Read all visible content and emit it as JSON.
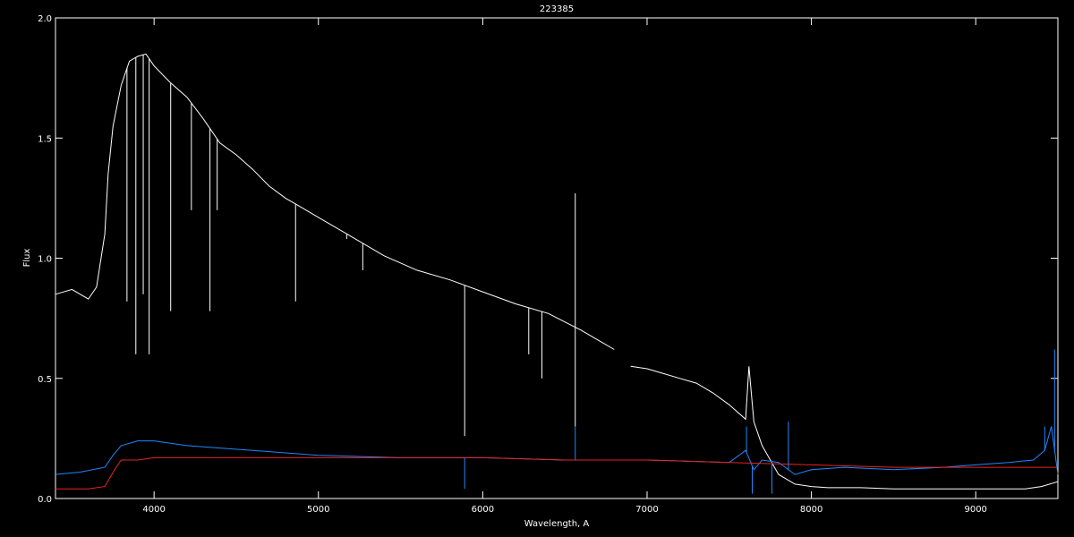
{
  "chart_data": {
    "type": "line",
    "title": "223385",
    "xlabel": "Wavelength, A",
    "ylabel": "Flux",
    "xlim": [
      3400,
      9500
    ],
    "ylim": [
      0,
      2.0
    ],
    "xticks": [
      4000,
      5000,
      6000,
      7000,
      8000,
      9000
    ],
    "yticks": [
      0.0,
      0.5,
      1.0,
      1.5,
      2.0
    ],
    "ytick_labels": [
      "0.0",
      "0.5",
      "1.0",
      "1.5",
      "2.0"
    ],
    "grid": false,
    "background": "#000000",
    "series": [
      {
        "color": "#ffffff",
        "segments": [
          {
            "x": [
              3400,
              3500,
              3600,
              3650,
              3700,
              3720,
              3750,
              3800,
              3850,
              3900,
              3950,
              4000,
              4100,
              4200,
              4300,
              4400,
              4500,
              4600,
              4700,
              4800,
              4900,
              5000,
              5200,
              5400,
              5600,
              5800,
              6000,
              6200,
              6400,
              6600,
              6700,
              6800
            ],
            "y": [
              0.85,
              0.87,
              0.83,
              0.88,
              1.1,
              1.35,
              1.55,
              1.72,
              1.82,
              1.84,
              1.85,
              1.8,
              1.73,
              1.67,
              1.58,
              1.48,
              1.43,
              1.37,
              1.3,
              1.25,
              1.21,
              1.17,
              1.09,
              1.01,
              0.95,
              0.91,
              0.86,
              0.81,
              0.77,
              0.7,
              0.66,
              0.62
            ]
          },
          {
            "x": [
              6900,
              7000,
              7100,
              7200,
              7300,
              7400,
              7500,
              7600,
              7620,
              7650,
              7700,
              7800,
              7900,
              8000,
              8100,
              8300,
              8500,
              8700,
              8900,
              9100,
              9300,
              9400,
              9500
            ],
            "y": [
              0.55,
              0.54,
              0.52,
              0.5,
              0.48,
              0.44,
              0.39,
              0.33,
              0.55,
              0.32,
              0.22,
              0.1,
              0.06,
              0.05,
              0.045,
              0.045,
              0.04,
              0.04,
              0.04,
              0.04,
              0.04,
              0.05,
              0.07
            ]
          }
        ],
        "absorption_lines": [
          {
            "x": 3835,
            "y_min": 0.82
          },
          {
            "x": 3889,
            "y_min": 0.6
          },
          {
            "x": 3934,
            "y_min": 0.85
          },
          {
            "x": 3970,
            "y_min": 0.6
          },
          {
            "x": 4101,
            "y_min": 0.78
          },
          {
            "x": 4227,
            "y_min": 1.2
          },
          {
            "x": 4340,
            "y_min": 0.78
          },
          {
            "x": 4384,
            "y_min": 1.2
          },
          {
            "x": 4861,
            "y_min": 0.82
          },
          {
            "x": 5172,
            "y_min": 1.08
          },
          {
            "x": 5270,
            "y_min": 0.95
          },
          {
            "x": 5890,
            "y_min": 0.26
          },
          {
            "x": 6563,
            "y_min": 0.3
          },
          {
            "x": 6360,
            "y_min": 0.5
          },
          {
            "x": 6280,
            "y_min": 0.6
          }
        ],
        "emission_lines": [
          {
            "x": 6563,
            "y_max": 1.27
          }
        ]
      },
      {
        "color": "#1e88ff",
        "x": [
          3400,
          3550,
          3700,
          3750,
          3800,
          3900,
          4000,
          4200,
          4400,
          4600,
          5000,
          5500,
          6000,
          6500,
          7000,
          7500,
          7600,
          7650,
          7700,
          7800,
          7900,
          8000,
          8200,
          8500,
          8800,
          9000,
          9200,
          9350,
          9420,
          9460,
          9500
        ],
        "y": [
          0.1,
          0.11,
          0.13,
          0.18,
          0.22,
          0.24,
          0.24,
          0.22,
          0.21,
          0.2,
          0.18,
          0.17,
          0.17,
          0.16,
          0.16,
          0.15,
          0.2,
          0.12,
          0.16,
          0.15,
          0.1,
          0.12,
          0.13,
          0.12,
          0.13,
          0.14,
          0.15,
          0.16,
          0.2,
          0.3,
          0.1
        ],
        "emission_lines": [
          {
            "x": 6563,
            "y_max": 0.3
          },
          {
            "x": 7605,
            "y_max": 0.3
          },
          {
            "x": 7860,
            "y_max": 0.32
          },
          {
            "x": 9420,
            "y_max": 0.3
          },
          {
            "x": 9480,
            "y_max": 0.62
          }
        ],
        "absorption_lines": [
          {
            "x": 5890,
            "y_min": 0.04
          },
          {
            "x": 7640,
            "y_min": 0.02
          },
          {
            "x": 7760,
            "y_min": 0.02
          }
        ]
      },
      {
        "color": "#e8251f",
        "x": [
          3400,
          3600,
          3700,
          3760,
          3800,
          3900,
          4000,
          4200,
          4500,
          5000,
          5500,
          6000,
          6500,
          7000,
          7500,
          8000,
          8500,
          9000,
          9500
        ],
        "y": [
          0.04,
          0.04,
          0.05,
          0.12,
          0.16,
          0.16,
          0.17,
          0.17,
          0.17,
          0.17,
          0.17,
          0.17,
          0.16,
          0.16,
          0.15,
          0.14,
          0.13,
          0.13,
          0.13
        ]
      }
    ]
  }
}
